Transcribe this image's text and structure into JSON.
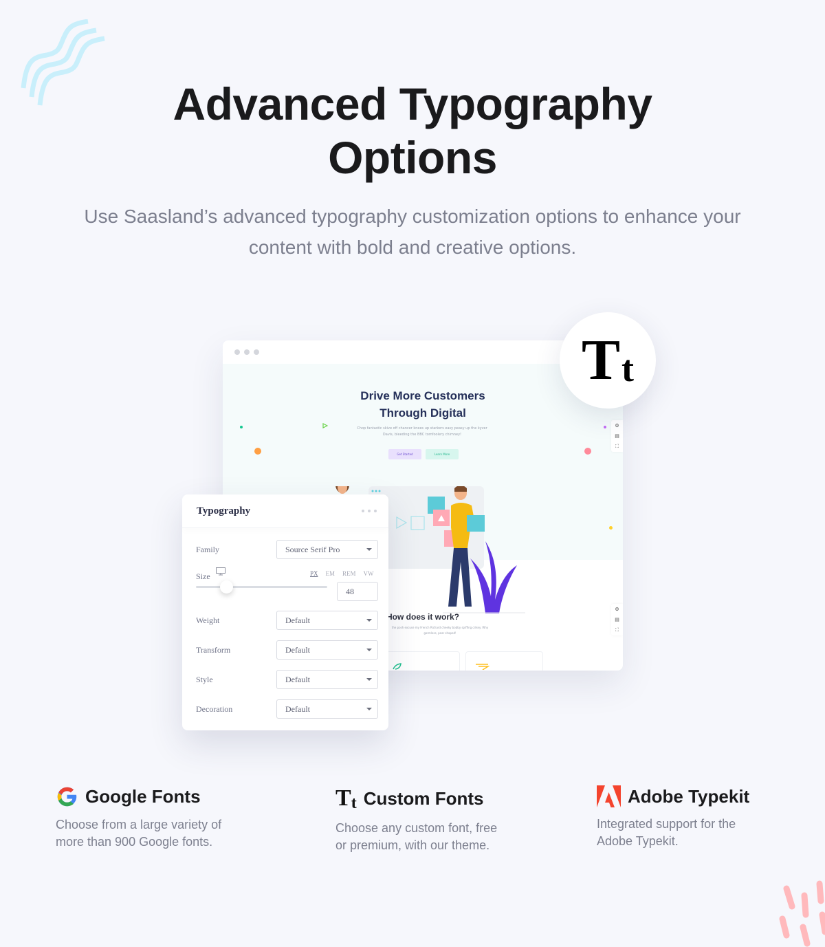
{
  "hero": {
    "title_line1": "Advanced Typography",
    "title_line2": "Options",
    "subtitle": "Use Saasland’s advanced typography customization options to enhance your content with bold and creative options."
  },
  "mockup": {
    "site_title_line1": "Drive More Customers",
    "site_title_line2": "Through Digital",
    "site_description": "Chop fantastic skive off chancer knees up starkers easy peasy up the kyver Davis, bleeding the BBC tomfoolery chimney!",
    "get_started_label": "Get Started",
    "learn_more_label": "Learn More",
    "section_title": "How does it work?",
    "section_description": "the posh excuse my French Richard cheeky bobby spiffing crikey. Why gormless, pear shaped!",
    "colors": {
      "purple": "#e9e0fd",
      "mint": "#d7f6ee",
      "orange": "#ff9f43",
      "pink": "#ff8a9a"
    }
  },
  "bubble": {
    "big": "T",
    "small": "t"
  },
  "panel": {
    "title": "Typography",
    "family_label": "Family",
    "family_value": "Source Serif Pro",
    "size_label": "Size",
    "units": [
      "PX",
      "EM",
      "REM",
      "VW"
    ],
    "active_unit": "PX",
    "size_value": "48",
    "rows": [
      {
        "label": "Weight",
        "value": "Default"
      },
      {
        "label": "Transform",
        "value": "Default"
      },
      {
        "label": "Style",
        "value": "Default"
      },
      {
        "label": "Decoration",
        "value": "Default"
      }
    ]
  },
  "features": [
    {
      "icon": "google-icon",
      "title": "Google Fonts",
      "desc_line1": "Choose from a large variety of",
      "desc_line2": "more than 900 Google fonts."
    },
    {
      "icon": "tt-icon",
      "title": "Custom Fonts",
      "desc_line1": "Choose any custom font, free",
      "desc_line2": "or premium, with our theme."
    },
    {
      "icon": "adobe-icon",
      "title": "Adobe Typekit",
      "desc_line1": "Integrated support for the",
      "desc_line2": "Adobe Typekit."
    }
  ]
}
